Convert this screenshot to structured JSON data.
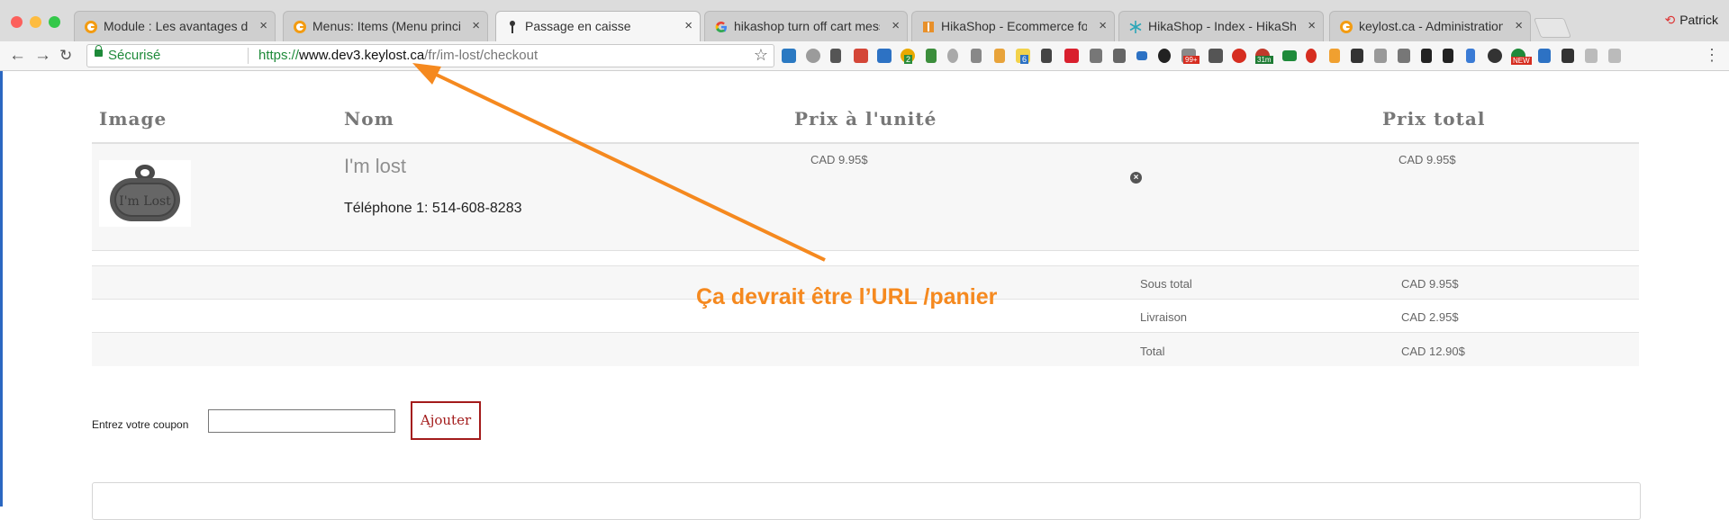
{
  "browser": {
    "tabs": [
      {
        "title": "Module : Les avantages des pr",
        "favicon": "g-icon",
        "active": false
      },
      {
        "title": "Menus: Items (Menu principal)",
        "favicon": "g-icon",
        "active": false
      },
      {
        "title": "Passage en caisse",
        "favicon": "pin-icon",
        "active": true
      },
      {
        "title": "hikashop turn off cart message",
        "favicon": "google-icon",
        "active": false
      },
      {
        "title": "HikaShop - Ecommerce for Joo",
        "favicon": "book-icon",
        "active": false
      },
      {
        "title": "HikaShop - Index - HikaShop",
        "favicon": "snowflake-icon",
        "active": false
      },
      {
        "title": "keylost.ca - Administration - C",
        "favicon": "g-icon",
        "active": false
      }
    ],
    "close_glyph": "×",
    "profile_name": "Patrick",
    "address": {
      "secure_label": "Sécurisé",
      "scheme": "https://",
      "host": "www.dev3.keylost.ca",
      "path": "/fr/im-lost/checkout"
    },
    "extension_badges": {
      "two": "2",
      "six": "6",
      "ninety_nine": "99+",
      "thirty_one": "31m",
      "new": "NEW"
    }
  },
  "cart": {
    "headers": {
      "image": "Image",
      "name": "Nom",
      "unit_price": "Prix à l'unité",
      "total_price": "Prix total"
    },
    "item": {
      "name": "I'm lost",
      "thumbnail_text": "I'm Lost",
      "detail": "Téléphone 1: 514-608-8283",
      "unit_price": "CAD 9.95$",
      "total_price": "CAD 9.95$"
    },
    "summary": [
      {
        "label": "Sous total",
        "value": "CAD 9.95$"
      },
      {
        "label": "Livraison",
        "value": "CAD 2.95$"
      },
      {
        "label": "Total",
        "value": "CAD 12.90$"
      }
    ]
  },
  "coupon": {
    "label": "Entrez votre coupon",
    "value": "",
    "button": "Ajouter"
  },
  "annotation": {
    "text": "Ça devrait être l’URL /panier",
    "color": "#f5891f"
  },
  "colors": {
    "secure": "#1e8a3a",
    "accent_button": "#a31b1b"
  }
}
